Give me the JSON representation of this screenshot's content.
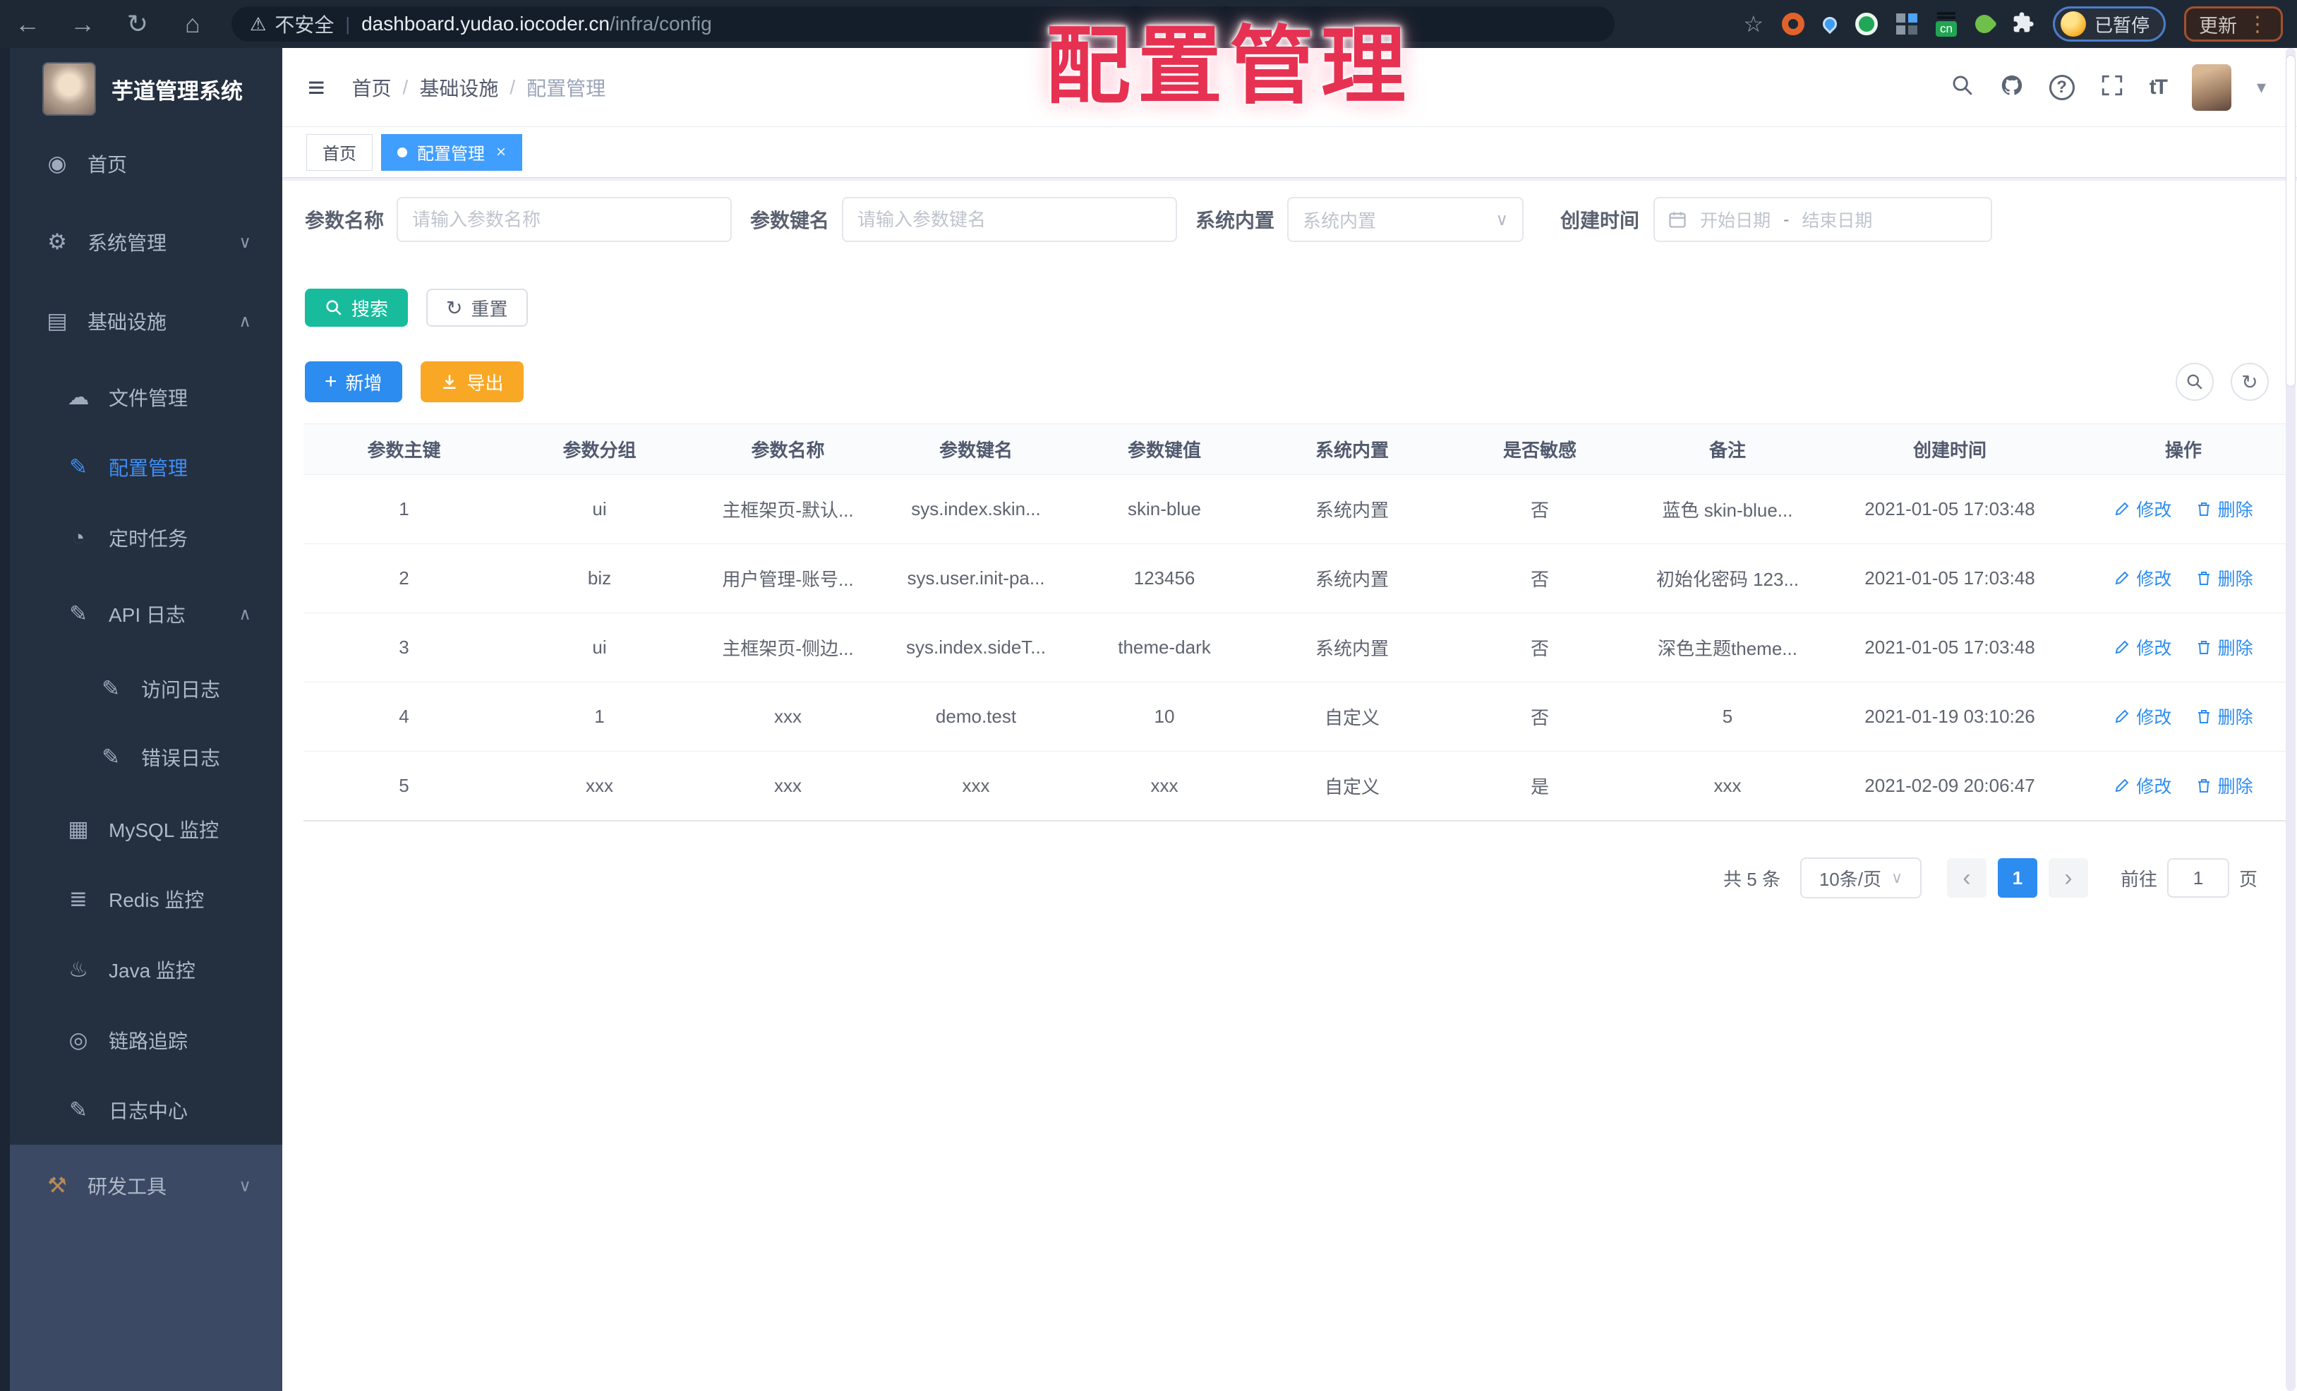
{
  "annotation": {
    "text": "配置管理",
    "color": "#e73152"
  },
  "browser": {
    "security_label": "不安全",
    "url_host": "dashboard.yudao.iocoder.cn",
    "url_path": "/infra/config",
    "cn_badge": "cn",
    "paused_badge": "已暂停",
    "update_button": "更新"
  },
  "icons": {
    "back": "←",
    "forward": "→",
    "reload": "↻",
    "home": "⌂",
    "warning": "⚠",
    "star": "☆",
    "dots": "⋮",
    "hamburger": "≡",
    "caret_down": "▾",
    "chevron_down": "∨",
    "chevron_up": "∧",
    "sep": "|",
    "slash": "/",
    "dashboard": "◉",
    "gear": "⚙",
    "infra": "▤",
    "cloud": "☁",
    "edit": "✎",
    "timer": "◔",
    "log": "✎",
    "mysql": "▦",
    "redis": "≣",
    "java": "♨",
    "eye": "◎",
    "tools": "⚒",
    "refresh": "↻",
    "plus": "+",
    "close": "×",
    "prev": "‹",
    "next": "›",
    "fontsize": "tT",
    "dash": "-"
  },
  "sidebar": {
    "title": "芋道管理系统",
    "items": [
      {
        "label": "首页"
      },
      {
        "label": "系统管理"
      },
      {
        "label": "基础设施"
      },
      {
        "label": "文件管理"
      },
      {
        "label": "配置管理"
      },
      {
        "label": "定时任务"
      },
      {
        "label": "API 日志"
      },
      {
        "label": "访问日志"
      },
      {
        "label": "错误日志"
      },
      {
        "label": "MySQL 监控"
      },
      {
        "label": "Redis 监控"
      },
      {
        "label": "Java 监控"
      },
      {
        "label": "链路追踪"
      },
      {
        "label": "日志中心"
      },
      {
        "label": "研发工具"
      }
    ]
  },
  "breadcrumb": {
    "items": [
      "首页",
      "基础设施",
      "配置管理"
    ]
  },
  "tags": {
    "home": "首页",
    "active": "配置管理"
  },
  "filters": {
    "name_label": "参数名称",
    "name_placeholder": "请输入参数名称",
    "key_label": "参数键名",
    "key_placeholder": "请输入参数键名",
    "type_label": "系统内置",
    "type_placeholder": "系统内置",
    "date_label": "创建时间",
    "date_start": "开始日期",
    "date_sep": "-",
    "date_end": "结束日期"
  },
  "toolbar": {
    "search": "搜索",
    "reset": "重置",
    "add": "新增",
    "export": "导出"
  },
  "table": {
    "headers": [
      "参数主键",
      "参数分组",
      "参数名称",
      "参数键名",
      "参数键值",
      "系统内置",
      "是否敏感",
      "备注",
      "创建时间",
      "操作"
    ],
    "actions": {
      "edit": "修改",
      "delete": "删除"
    },
    "rows": [
      [
        "1",
        "ui",
        "主框架页-默认...",
        "sys.index.skin...",
        "skin-blue",
        "系统内置",
        "否",
        "蓝色 skin-blue...",
        "2021-01-05 17:03:48"
      ],
      [
        "2",
        "biz",
        "用户管理-账号...",
        "sys.user.init-pa...",
        "123456",
        "系统内置",
        "否",
        "初始化密码 123...",
        "2021-01-05 17:03:48"
      ],
      [
        "3",
        "ui",
        "主框架页-侧边...",
        "sys.index.sideT...",
        "theme-dark",
        "系统内置",
        "否",
        "深色主题theme...",
        "2021-01-05 17:03:48"
      ],
      [
        "4",
        "1",
        "xxx",
        "demo.test",
        "10",
        "自定义",
        "否",
        "5",
        "2021-01-19 03:10:26"
      ],
      [
        "5",
        "xxx",
        "xxx",
        "xxx",
        "xxx",
        "自定义",
        "是",
        "xxx",
        "2021-02-09 20:06:47"
      ]
    ]
  },
  "pagination": {
    "total": "共 5 条",
    "page_size": "10条/页",
    "current": "1",
    "goto_label": "前往",
    "goto_value": "1",
    "page_unit": "页"
  },
  "colors": {
    "primary": "#409eff",
    "search_btn": "#18bc9c",
    "add_btn": "#2d8cf0",
    "export_btn": "#f9a825",
    "link": "#2d8cf0",
    "annotation": "#e73152",
    "sidebar_bg": "#242f40",
    "sidebar_bottom_bg": "#3c4965",
    "browser_bar_bg": "#1e2835"
  }
}
